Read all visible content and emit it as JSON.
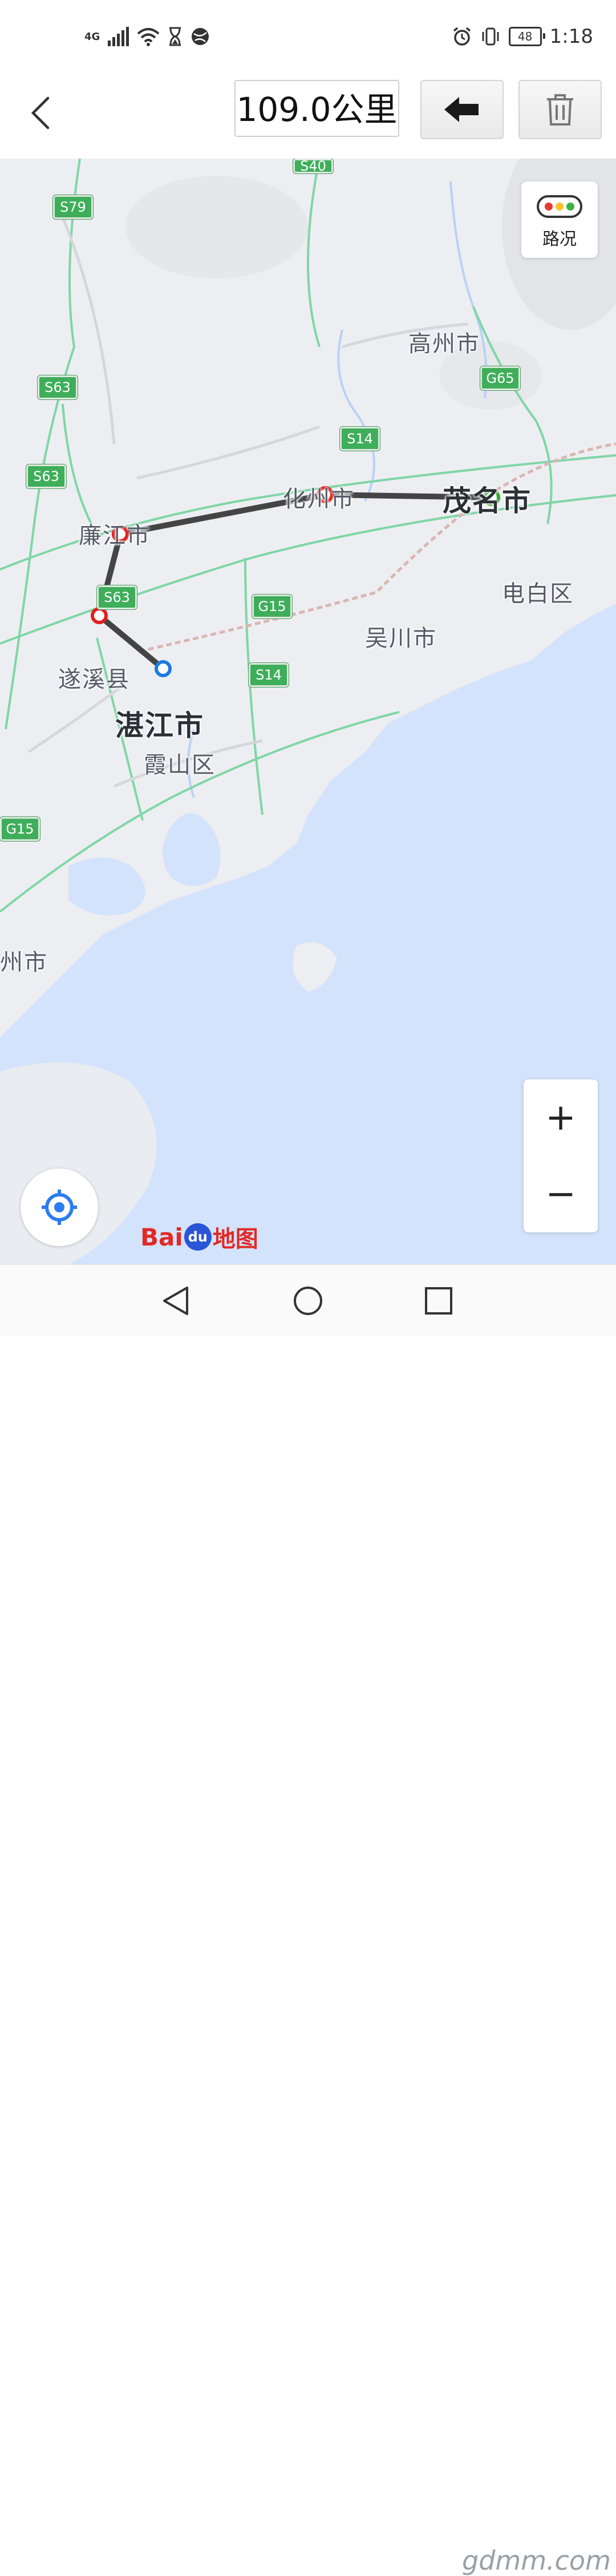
{
  "status_bar": {
    "network": "4G",
    "battery": "48",
    "time": "1:18"
  },
  "toolbar": {
    "distance": "109.0公里"
  },
  "map": {
    "places": [
      {
        "id": "gaozhou",
        "label": "高州市",
        "big": false
      },
      {
        "id": "huazhou",
        "label": "化州市",
        "big": false
      },
      {
        "id": "maoming",
        "label": "茂名市",
        "big": true
      },
      {
        "id": "lianjiang",
        "label": "廉江市",
        "big": false
      },
      {
        "id": "dianbai",
        "label": "电白区",
        "big": false
      },
      {
        "id": "wuchuan",
        "label": "吴川市",
        "big": false
      },
      {
        "id": "suixi",
        "label": "遂溪县",
        "big": false
      },
      {
        "id": "zhanjiang",
        "label": "湛江市",
        "big": true
      },
      {
        "id": "xiashan",
        "label": "霞山区",
        "big": false
      },
      {
        "id": "leizhou",
        "label": "州市",
        "big": false
      }
    ],
    "highways": [
      "S40",
      "S79",
      "S63",
      "S63",
      "G65",
      "S14",
      "S63",
      "G15",
      "S14",
      "G15"
    ],
    "traffic_label": "路况",
    "zoom_in": "+",
    "zoom_out": "−",
    "logo": {
      "bai": "Bai",
      "du": "du",
      "cn": "地图"
    },
    "route_colors": {
      "line": "#444444",
      "waypoint": "#e02020",
      "start": "#2ea82e",
      "end": "#1a7be0"
    }
  },
  "watermark": "gdmm.com"
}
